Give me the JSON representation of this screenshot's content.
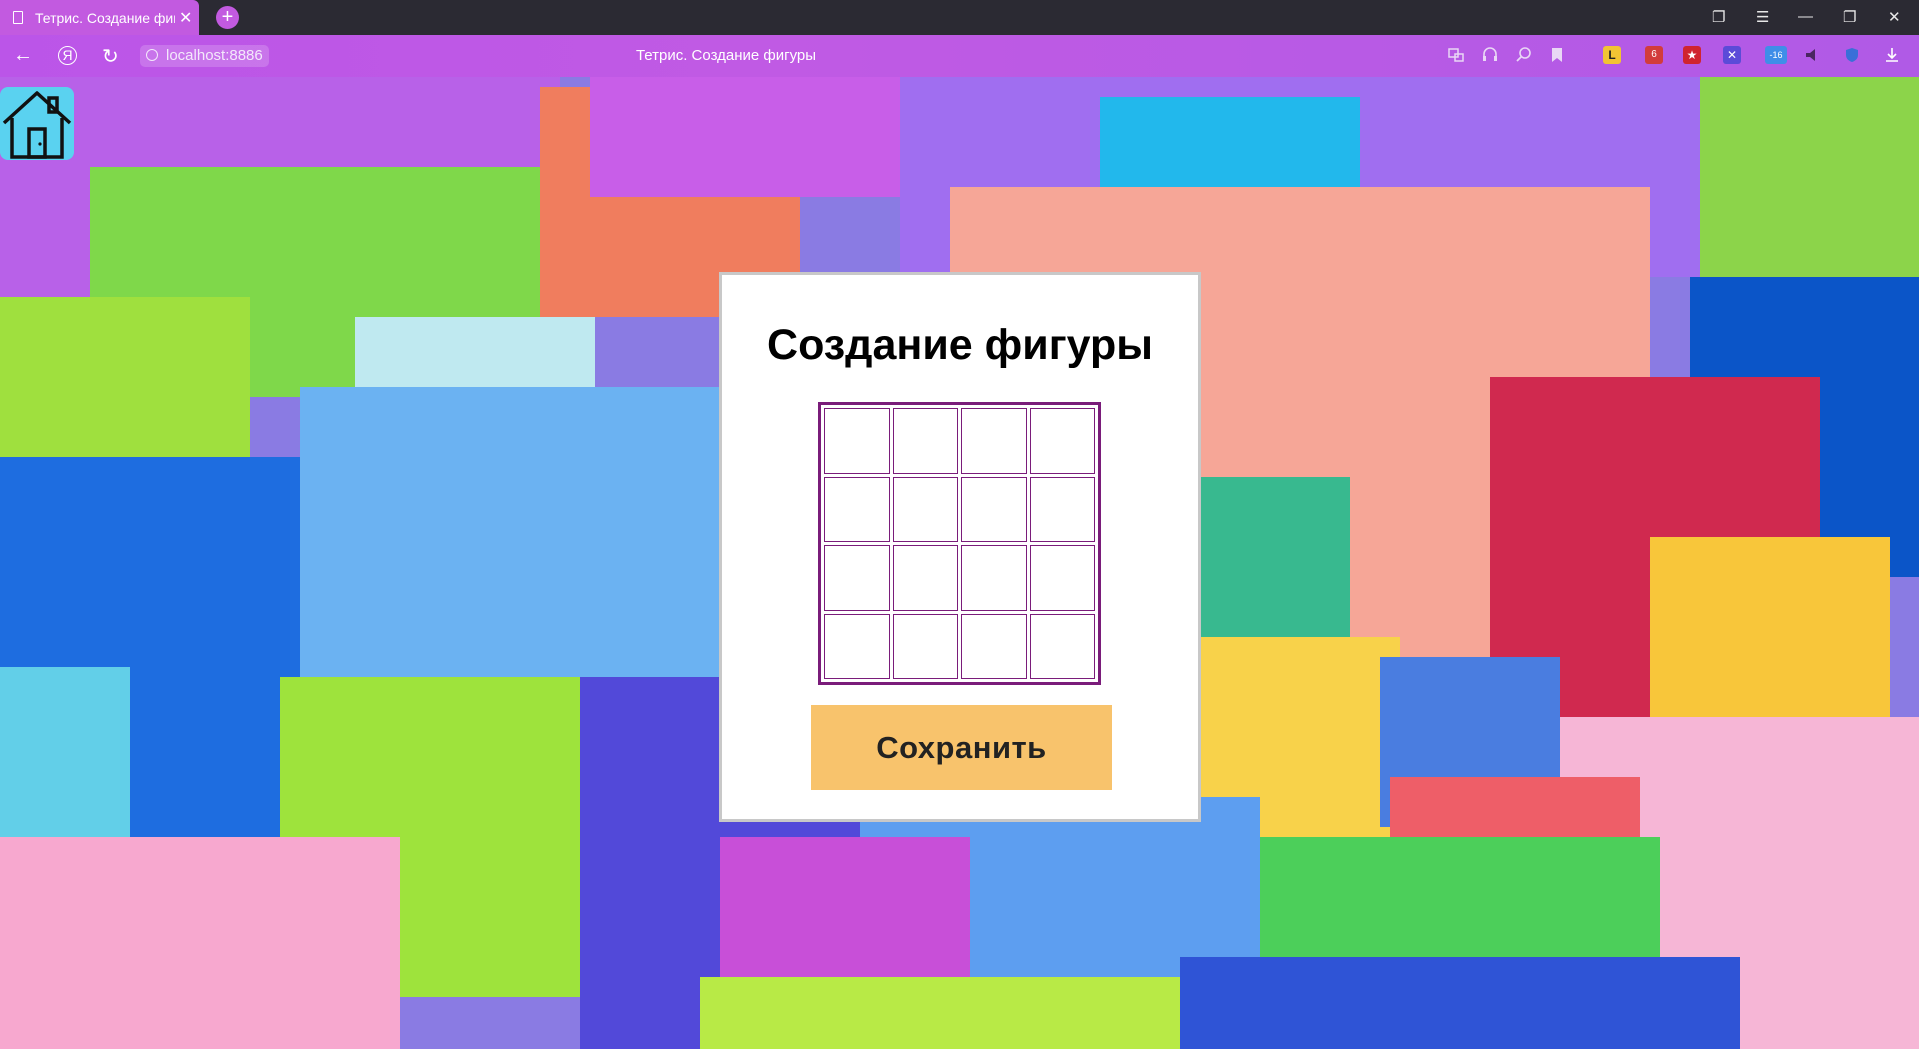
{
  "browser": {
    "tab_title": "Тетрис. Создание фигуры",
    "tab_close": "✕",
    "new_tab": "+",
    "address": "localhost:8886",
    "page_title": "Тетрис. Создание фигуры",
    "nav": {
      "back": "←",
      "yandex": "Я",
      "reload": "↻"
    },
    "window_controls": {
      "collections": "❐",
      "menu": "☰",
      "minimize": "—",
      "restore": "❐",
      "close": "✕"
    },
    "extensions": [
      {
        "name": "translate-icon"
      },
      {
        "name": "reader-icon"
      },
      {
        "name": "zoom-icon"
      },
      {
        "name": "bookmark-icon"
      },
      {
        "name": "ext-lingvo-icon",
        "label": "L",
        "color": "#f2c433"
      },
      {
        "name": "ext-mail-icon",
        "label": "6",
        "color": "#d23c3c"
      },
      {
        "name": "ext-star-icon",
        "label": "★",
        "color": "#d0242f"
      },
      {
        "name": "ext-x-icon",
        "label": "✕",
        "color": "#5b4bd8"
      },
      {
        "name": "ext-weather-icon",
        "label": "-16",
        "color": "#3f8ee8"
      },
      {
        "name": "sound-icon"
      },
      {
        "name": "protect-icon"
      },
      {
        "name": "download-icon"
      }
    ]
  },
  "page": {
    "title": "Создание фигуры",
    "grid": {
      "rows": 4,
      "cols": 4,
      "filled": []
    },
    "save_label": "Сохранить",
    "colors": {
      "card_bg": "#ffffff",
      "grid_border": "#7a1c7a",
      "button_bg": "#f8c36c",
      "home_bg": "#5ad2f0",
      "toolbar": "#c05ae4"
    }
  }
}
